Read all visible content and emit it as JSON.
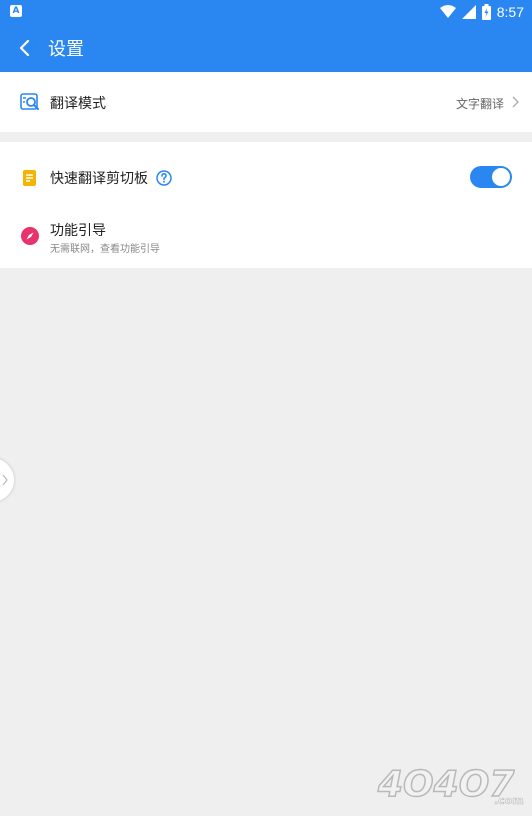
{
  "statusbar": {
    "time": "8:57",
    "left_badge": "A"
  },
  "appbar": {
    "title": "设置"
  },
  "settings": {
    "translate_mode": {
      "label": "翻译模式",
      "value": "文字翻译"
    },
    "quick_clipboard": {
      "label": "快速翻译剪切板",
      "enabled": true
    },
    "feature_guide": {
      "label": "功能引导",
      "subtitle": "无需联网，查看功能引导"
    }
  },
  "watermark": {
    "text": "4O4O7",
    "suffix": ".com"
  },
  "colors": {
    "accent": "#2a87f2",
    "background": "#efefef",
    "clipboard_icon": "#f5b400",
    "guide_icon": "#e8336d"
  }
}
